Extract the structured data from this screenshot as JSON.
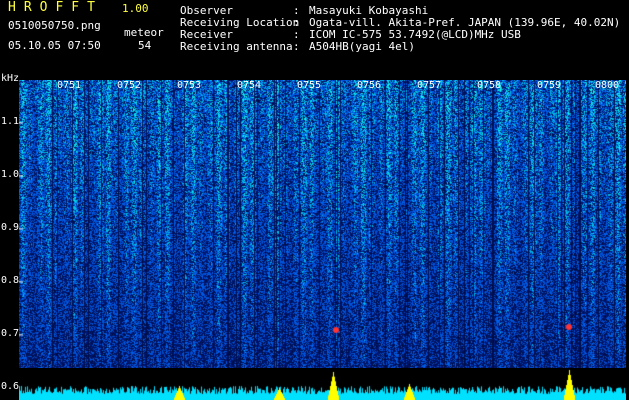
{
  "app": {
    "title": "HROFFT",
    "version": "1.00",
    "file_name": "0510050750.png",
    "datetime": "05.10.05 07:50",
    "meteor_label": "meteor",
    "meteor_count": "54"
  },
  "info": [
    {
      "key": "Observer",
      "sep": ":",
      "value": "Masayuki Kobayashi"
    },
    {
      "key": "Receiving Location",
      "sep": ":",
      "value": "Ogata-vill. Akita-Pref. JAPAN (139.96E, 40.02N)"
    },
    {
      "key": "Receiver",
      "sep": ":",
      "value": "ICOM IC-575 53.7492(@LCD)MHz USB"
    },
    {
      "key": "Receiving antenna",
      "sep": ":",
      "value": "A504HB(yagi 4el)"
    }
  ],
  "chart_data": {
    "type": "heatmap",
    "xlabel": "",
    "ylabel": "kHz",
    "x_ticks": [
      "0751",
      "0752",
      "0753",
      "0754",
      "0755",
      "0756",
      "0757",
      "0758",
      "0759",
      "0800"
    ],
    "y_ticks": [
      "1.1",
      "1.0",
      "0.9",
      "0.8",
      "0.7",
      "0.6"
    ],
    "ylim": [
      0.58,
      1.18
    ],
    "colors": {
      "background": "#000000",
      "low": "#001a66",
      "mid": "#1e5bff",
      "high": "#00e5c8",
      "peak": "#ff3333",
      "strip": "#00e0ff",
      "meteor_marker": "#ffff00"
    }
  }
}
